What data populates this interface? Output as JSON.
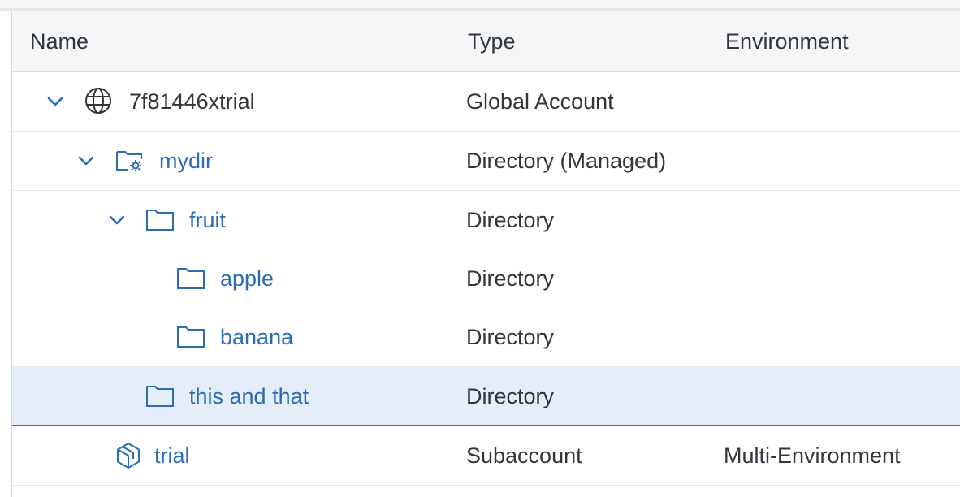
{
  "columns": {
    "name": "Name",
    "type": "Type",
    "environment": "Environment"
  },
  "rows": [
    {
      "name": "7f81446xtrial",
      "type": "Global Account",
      "environment": "",
      "icon": "globe-icon",
      "expanded": true
    },
    {
      "name": "mydir",
      "type": "Directory (Managed)",
      "environment": "",
      "icon": "managed-folder-icon",
      "expanded": true
    },
    {
      "name": "fruit",
      "type": "Directory",
      "environment": "",
      "icon": "folder-icon",
      "expanded": true
    },
    {
      "name": "apple",
      "type": "Directory",
      "environment": "",
      "icon": "folder-icon"
    },
    {
      "name": "banana",
      "type": "Directory",
      "environment": "",
      "icon": "folder-icon"
    },
    {
      "name": "this and that",
      "type": "Directory",
      "environment": "",
      "icon": "folder-icon",
      "selected": true
    },
    {
      "name": "trial",
      "type": "Subaccount",
      "environment": "Multi-Environment",
      "icon": "subaccount-icon"
    }
  ],
  "colors": {
    "link": "#2b6cb7",
    "text": "#32363a",
    "selected_bg": "#e5eef8",
    "selected_border": "#3f6fa5"
  }
}
